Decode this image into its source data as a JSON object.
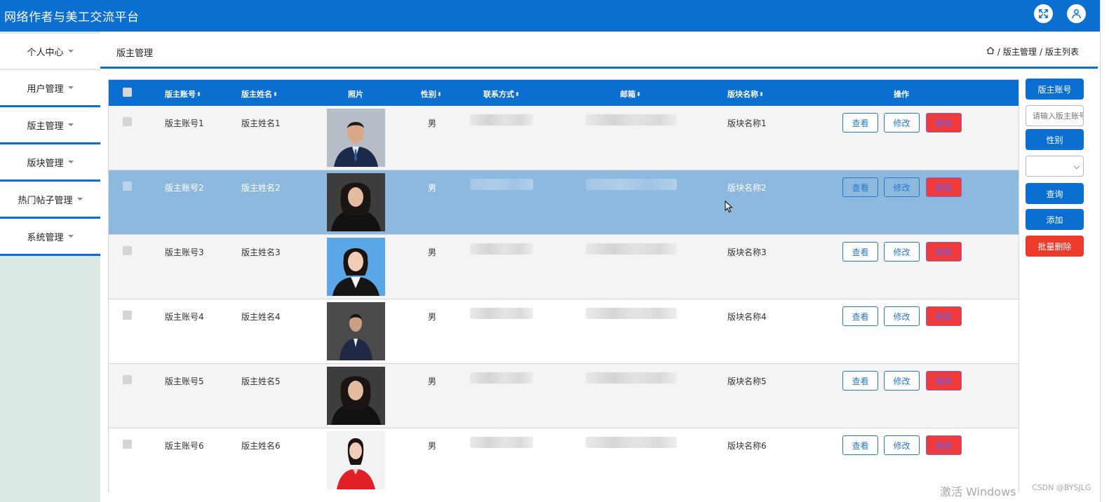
{
  "app": {
    "title": "网络作者与美工交流平台"
  },
  "header_icons": [
    "fullscreen-icon",
    "user-icon"
  ],
  "breadcrumb": {
    "page_title": "版主管理",
    "items": [
      "版主管理",
      "版主列表"
    ],
    "separator": "/"
  },
  "sidebar": {
    "items": [
      {
        "label": "个人中心"
      },
      {
        "label": "用户管理"
      },
      {
        "label": "版主管理"
      },
      {
        "label": "版块管理"
      },
      {
        "label": "热门帖子管理"
      },
      {
        "label": "系统管理"
      }
    ]
  },
  "table": {
    "columns": [
      "版主账号",
      "版主姓名",
      "照片",
      "性别",
      "联系方式",
      "邮箱",
      "版块名称",
      "操作"
    ],
    "sortable_mark": "⬍",
    "rows": [
      {
        "account": "版主账号1",
        "name": "版主姓名1",
        "gender": "男",
        "board": "版块名称1"
      },
      {
        "account": "版主账号2",
        "name": "版主姓名2",
        "gender": "男",
        "board": "版块名称2"
      },
      {
        "account": "版主账号3",
        "name": "版主姓名3",
        "gender": "男",
        "board": "版块名称3"
      },
      {
        "account": "版主账号4",
        "name": "版主姓名4",
        "gender": "男",
        "board": "版块名称4"
      },
      {
        "account": "版主账号5",
        "name": "版主姓名5",
        "gender": "男",
        "board": "版块名称5"
      },
      {
        "account": "版主账号6",
        "name": "版主姓名6",
        "gender": "男",
        "board": "版块名称6"
      }
    ],
    "actions": {
      "view": "查看",
      "edit": "修改",
      "delete": "删除"
    }
  },
  "filter_panel": {
    "account_label": "版主账号",
    "account_placeholder": "请输入版主账号",
    "gender_label": "性别",
    "gender_selected": "",
    "query_button": "查询",
    "add_button": "添加",
    "batch_delete_button": "批量删除"
  },
  "overlay": {
    "windows_activation": "激活 Windows",
    "csdn": "CSDN @BYSJLG"
  },
  "colors": {
    "primary": "#0a6fd0",
    "danger": "#ef3b3b",
    "selected_row": "#8db9df"
  }
}
